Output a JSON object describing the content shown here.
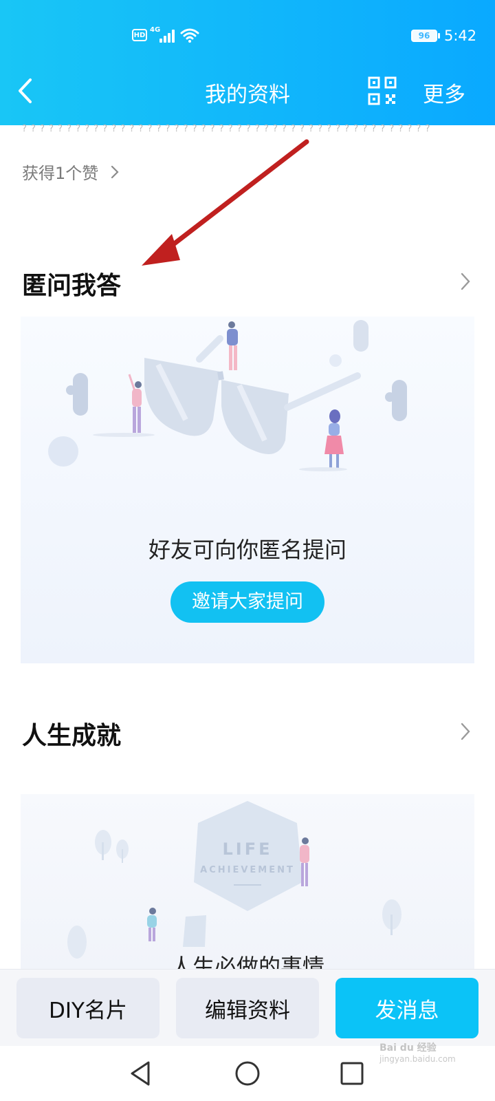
{
  "status_bar": {
    "hd": "HD",
    "network": "4G",
    "battery": "96",
    "time": "5:42"
  },
  "nav": {
    "title": "我的资料",
    "more_label": "更多",
    "back_icon": "chevron-left-icon",
    "qr_icon": "qr-code-icon"
  },
  "truncated_text": "? ? ? ? ? ? ? ? ? ? ? ? ? ? ? ? ? ? ? ? ? ? ? ? ? ? ? ? ? ? ? ? ? ? ? ? ? ? ? ? ? ? ? ? ? ?",
  "likes": {
    "label": "获得1个赞"
  },
  "qa_section": {
    "title": "匿问我答",
    "description": "好友可向你匿名提问",
    "button_label": "邀请大家提问"
  },
  "achievement_section": {
    "title": "人生成就",
    "badge_line1": "LIFE",
    "badge_line2": "ACHIEVEMENT",
    "partial_text": "人生必做的事情"
  },
  "bottom_bar": {
    "diy_label": "DIY名片",
    "edit_label": "编辑资料",
    "send_label": "发消息"
  },
  "watermark": {
    "brand": "Bai du 经验",
    "url": "jingyan.baidu.com"
  },
  "colors": {
    "header_start": "#19c6f6",
    "header_end": "#0aa9ff",
    "accent": "#12c1f2",
    "annotation_arrow": "#c0201f"
  }
}
